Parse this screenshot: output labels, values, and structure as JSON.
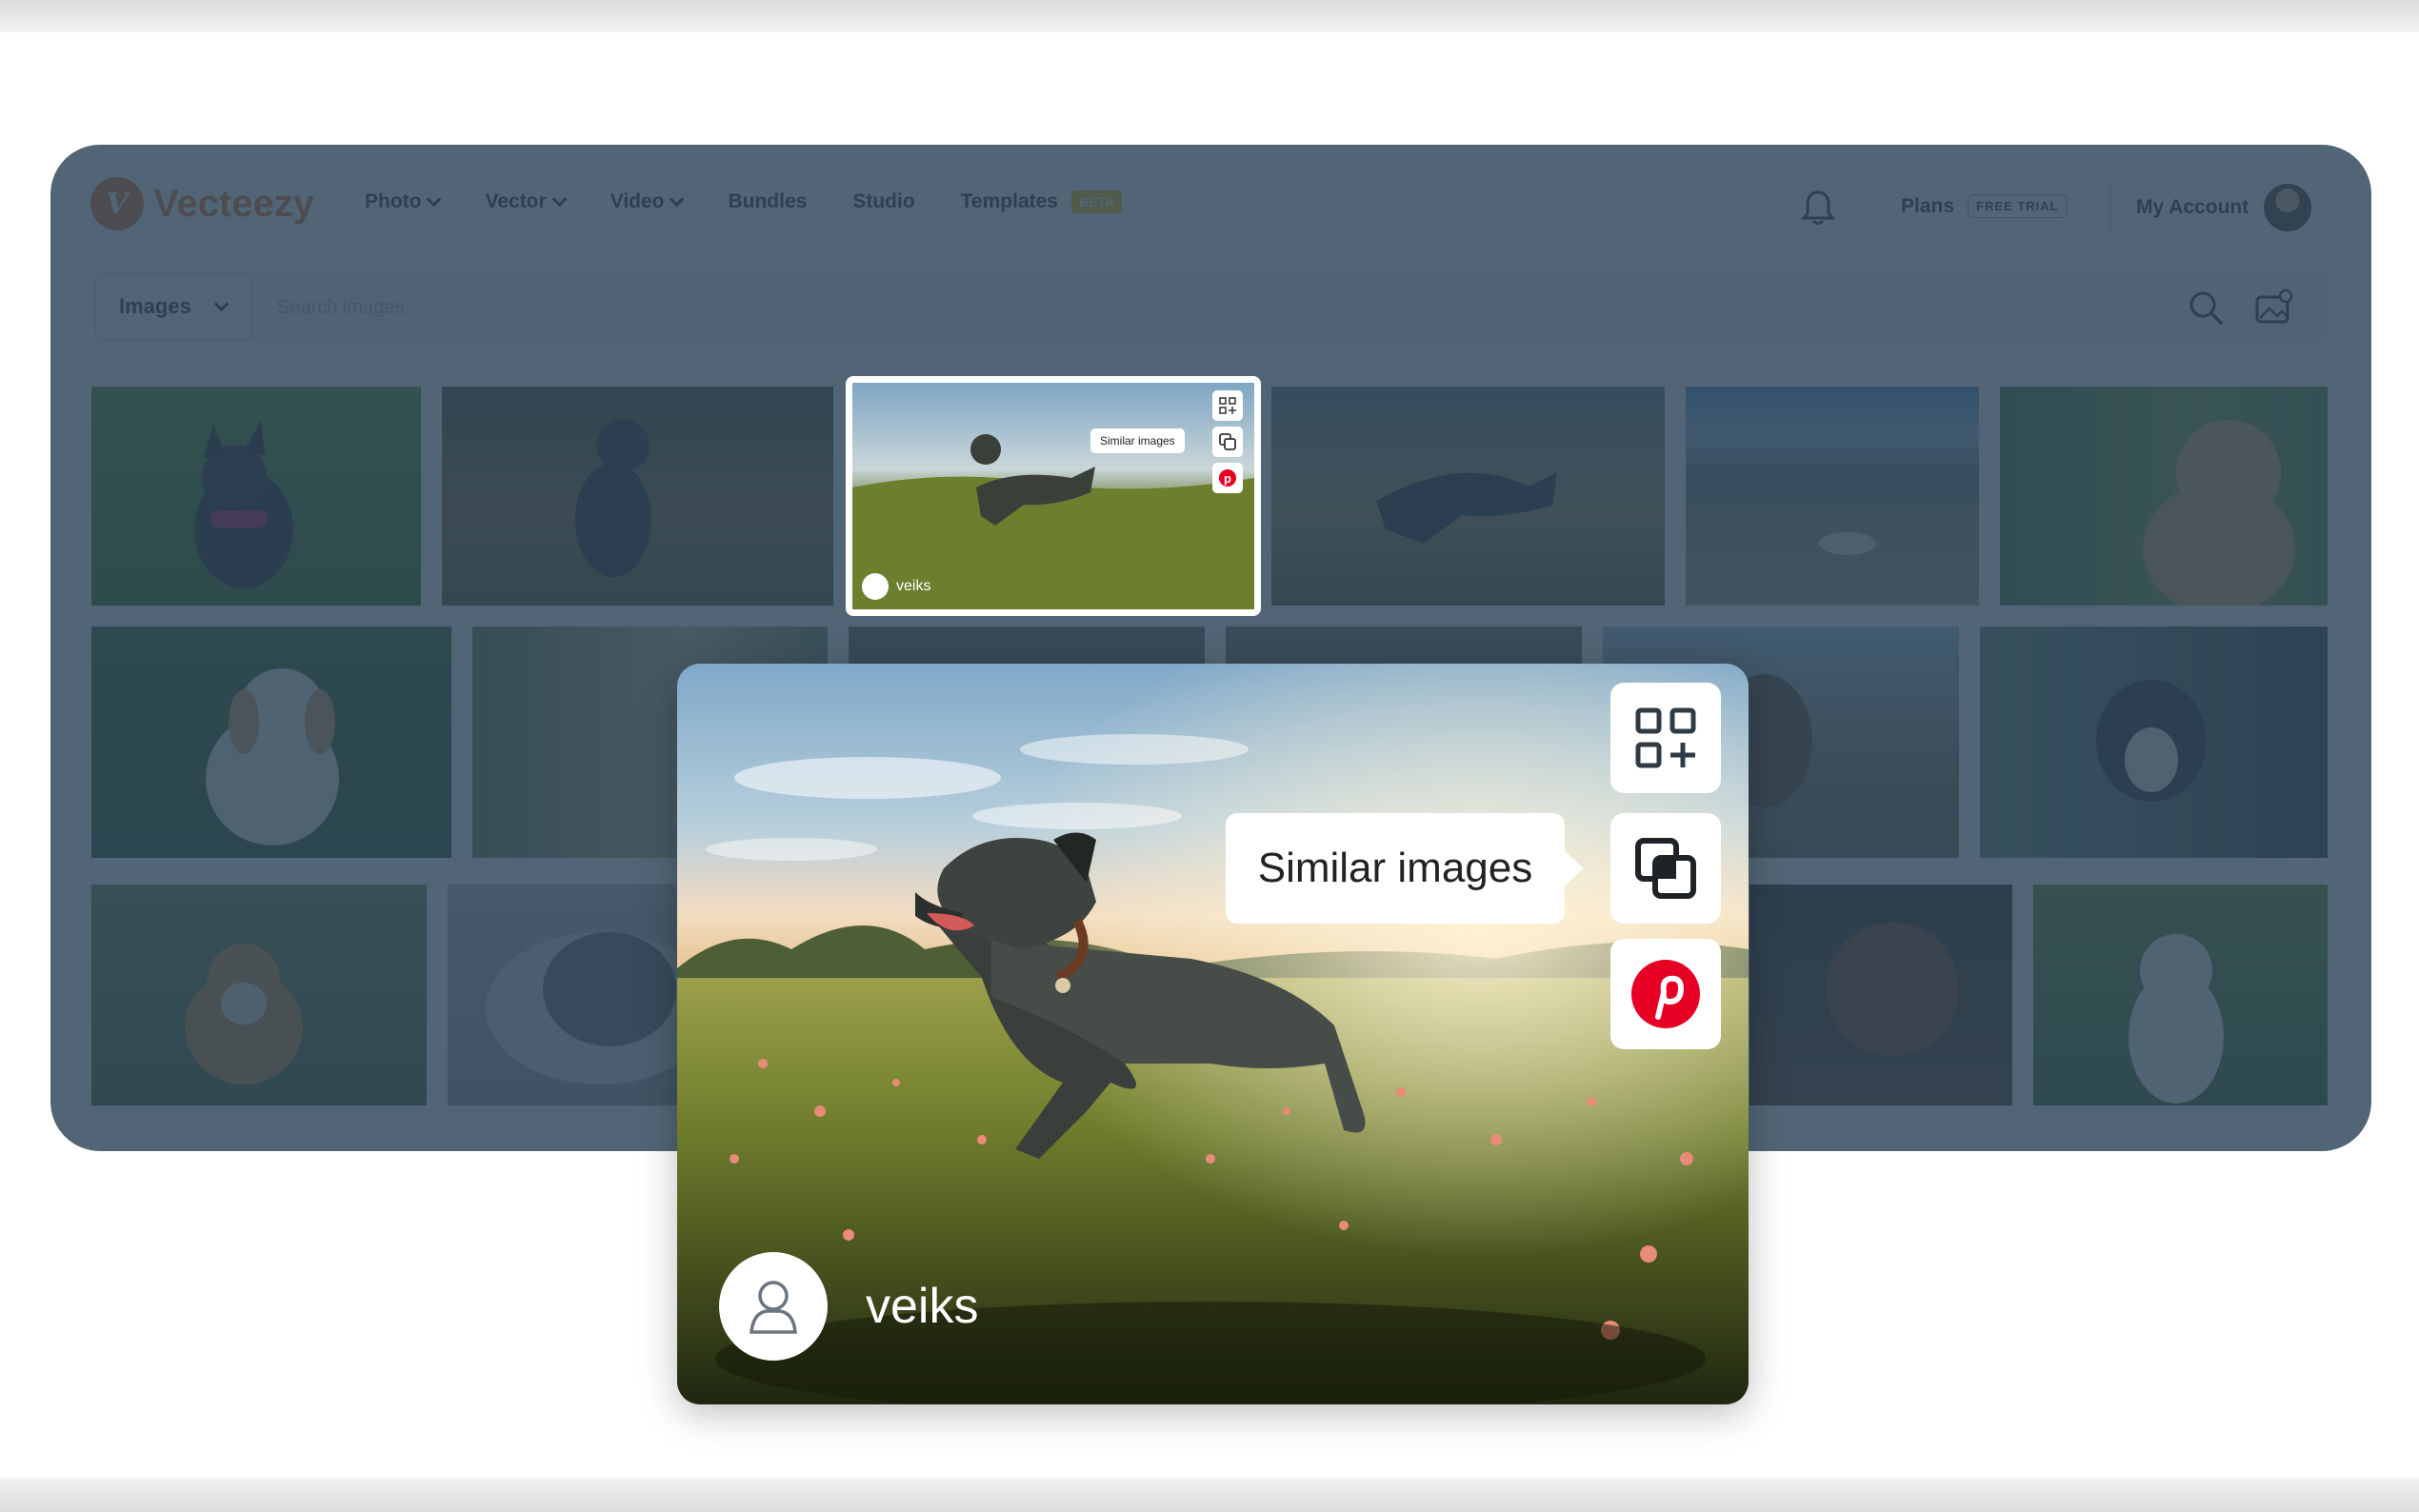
{
  "brand": {
    "name": "Vecteezy",
    "accent": "#e8772e"
  },
  "nav": {
    "items": [
      {
        "label": "Photo",
        "dropdown": true
      },
      {
        "label": "Vector",
        "dropdown": true
      },
      {
        "label": "Video",
        "dropdown": true
      },
      {
        "label": "Bundles",
        "dropdown": false
      },
      {
        "label": "Studio",
        "dropdown": false
      },
      {
        "label": "Templates",
        "dropdown": false,
        "badge": "BETA"
      }
    ],
    "plans": {
      "label": "Plans",
      "badge": "FREE TRIAL"
    },
    "account": {
      "label": "My Account"
    }
  },
  "search": {
    "type_value": "Images",
    "placeholder": "Search images..."
  },
  "highlighted": {
    "author": "veiks",
    "tooltip": "Similar images"
  },
  "card": {
    "author": "veiks",
    "tooltip": "Similar images",
    "buttons": [
      "collection-add-icon",
      "similar-images-icon",
      "pinterest-icon"
    ],
    "pinterest_color": "#e60023"
  },
  "overlay_color": "#2b4358"
}
